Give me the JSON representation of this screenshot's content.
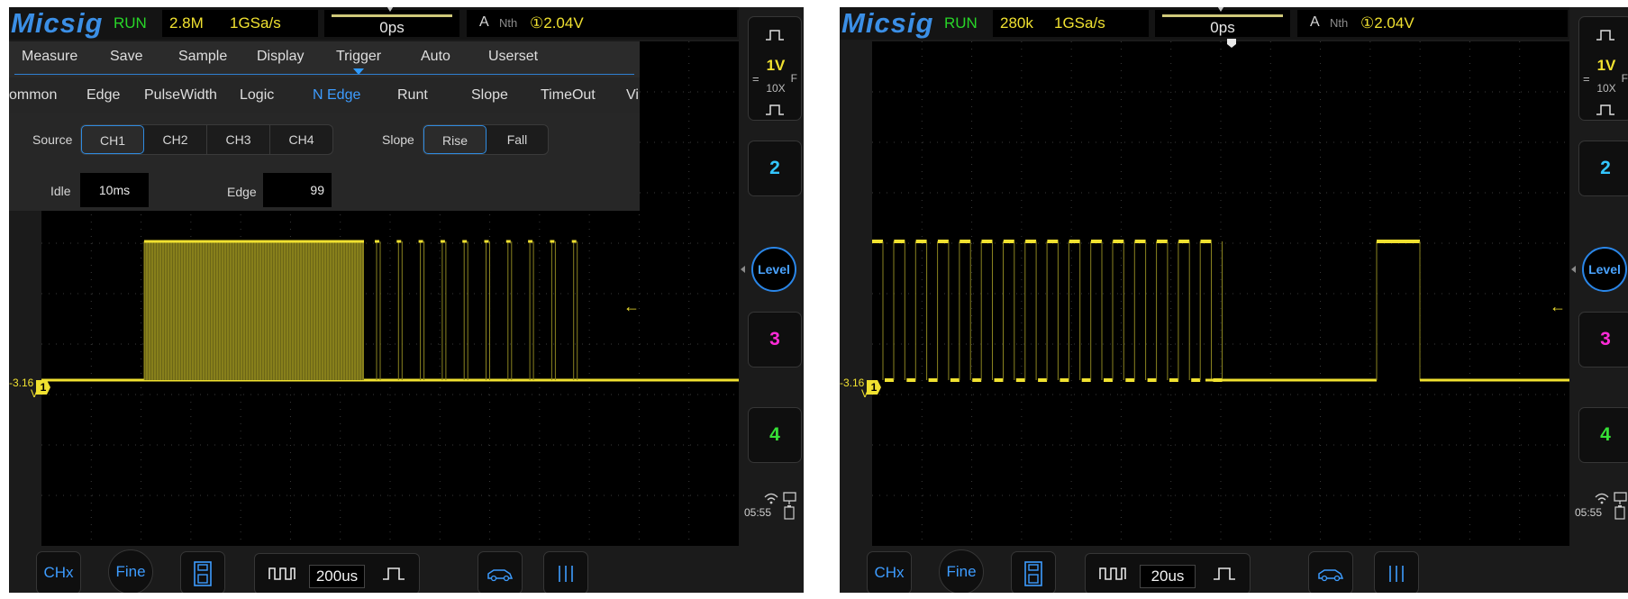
{
  "left": {
    "brand": "Micsig",
    "status": "RUN",
    "memory_depth": "2.8M",
    "sample_rate": "1GSa/s",
    "time_offset": "0ps",
    "trigger": {
      "source": "A",
      "type": "Nth",
      "channel_level": "①2.04V"
    },
    "menu": [
      "Measure",
      "Save",
      "Sample",
      "Display",
      "Trigger",
      "Auto",
      "Userset"
    ],
    "submenu": [
      "ommon",
      "Edge",
      "PulseWidth",
      "Logic",
      "N Edge",
      "Runt",
      "Slope",
      "TimeOut",
      "Vi"
    ],
    "submenu_active": "N Edge",
    "options": {
      "source_label": "Source",
      "sources": [
        "CH1",
        "CH2",
        "CH3",
        "CH4"
      ],
      "slope_label": "Slope",
      "slopes": [
        "Rise",
        "Fall"
      ],
      "idle_label": "Idle",
      "idle_value": "10ms",
      "edge_label": "Edge",
      "edge_value": "99"
    },
    "ch1_offset_label": "-3.16",
    "ch1_offset_unit": "V",
    "ch1_marker": "1",
    "timebase": "200us"
  },
  "right": {
    "brand": "Micsig",
    "status": "RUN",
    "memory_depth": "280k",
    "sample_rate": "1GSa/s",
    "time_offset": "0ps",
    "trigger": {
      "source": "A",
      "type": "Nth",
      "channel_level": "①2.04V"
    },
    "ch1_offset_label": "-3.16",
    "ch1_offset_unit": "V",
    "ch1_marker": "1",
    "timebase": "20us"
  },
  "sidebar": {
    "ch1_volts_div": "1V",
    "ch1_coupling": "=",
    "ch1_bw": "F",
    "ch1_probe": "10X",
    "ch2": "2",
    "ch3": "3",
    "ch4": "4",
    "level": "Level",
    "colors": {
      "ch2": "#33c6ff",
      "ch3": "#ff2bd8",
      "ch4": "#36e036"
    }
  },
  "bottom": {
    "chx": "CHx",
    "fine": "Fine"
  },
  "clock": "05:55"
}
